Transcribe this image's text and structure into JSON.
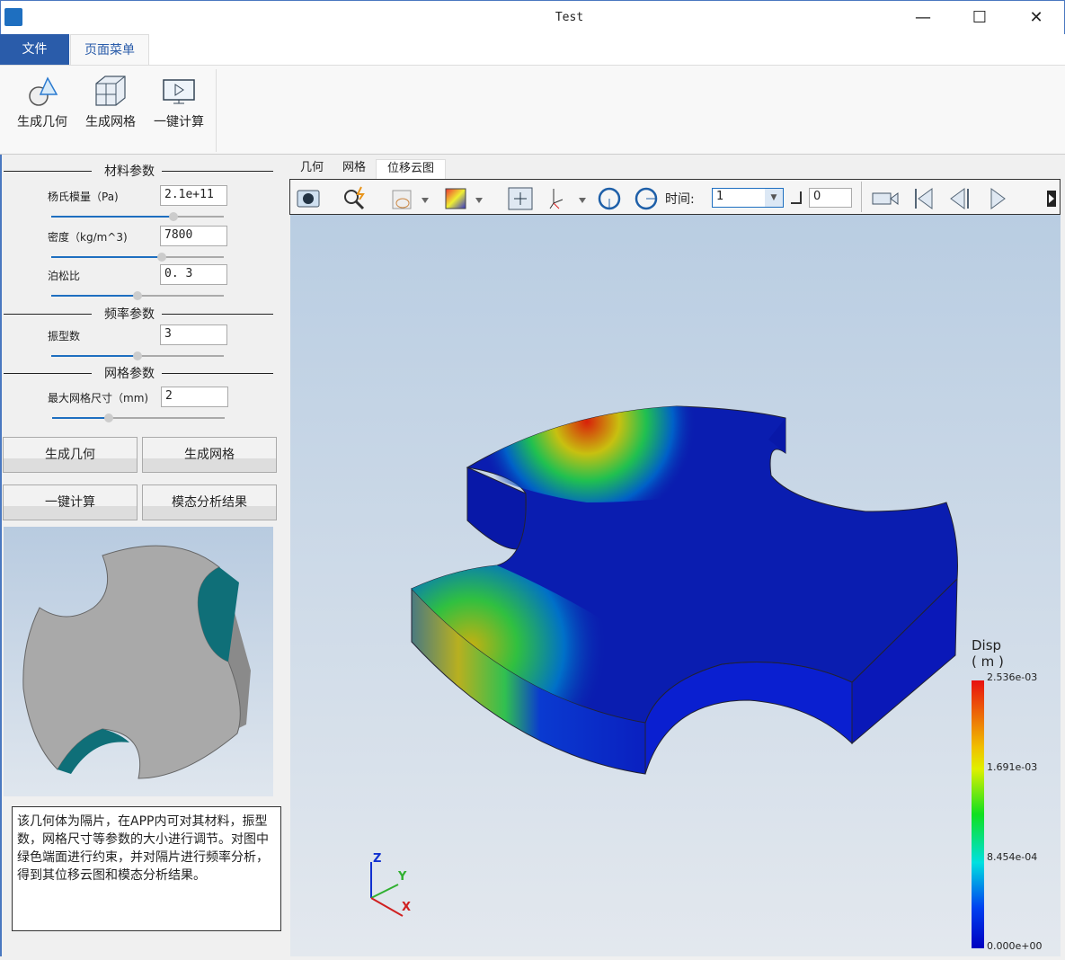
{
  "window": {
    "title": "Test",
    "min": "—",
    "max": "☐",
    "close": "✕"
  },
  "ribbon": {
    "tabs": [
      {
        "label": "文件",
        "active": false
      },
      {
        "label": "页面菜单",
        "active": true
      }
    ],
    "buttons": [
      {
        "label": "生成几何",
        "icon": "geometry-icon"
      },
      {
        "label": "生成网格",
        "icon": "mesh-cube-icon"
      },
      {
        "label": "一键计算",
        "icon": "monitor-play-icon"
      }
    ]
  },
  "panel": {
    "sections": {
      "material": "材料参数",
      "frequency": "频率参数",
      "mesh": "网格参数"
    },
    "fields": [
      {
        "label": "杨氏模量（Pa)",
        "value": "2.1e+11",
        "slider": 0.71
      },
      {
        "label": "密度（kg/m^3)",
        "value": "7800",
        "slider": 0.64
      },
      {
        "label": "泊松比",
        "value": "0. 3",
        "slider": 0.5
      },
      {
        "label": "振型数",
        "value": "3",
        "slider": 0.5
      },
      {
        "label": "最大网格尺寸（mm)",
        "value": "2",
        "slider": 0.33
      }
    ],
    "buttons": [
      "生成几何",
      "生成网格",
      "一键计算",
      "模态分析结果"
    ],
    "description": "该几何体为隔片，在APP内可对其材料，振型数，网格尺寸等参数的大小进行调节。对图中绿色端面进行约束，并对隔片进行频率分析，得到其位移云图和模态分析结果。"
  },
  "viewer": {
    "tabs": [
      "几何",
      "网格",
      "位移云图"
    ],
    "active_tab": "位移云图",
    "toolbar": {
      "time_label": "时间:",
      "time_value": "1",
      "step_value": "0"
    },
    "legend": {
      "title": "Disp",
      "unit": "( m )",
      "ticks": [
        "2.536e-03",
        "1.691e-03",
        "8.454e-04",
        "0.000e+00"
      ]
    },
    "axes": {
      "x": "X",
      "y": "Y",
      "z": "Z"
    }
  },
  "colors": {
    "accent": "#2a5caa",
    "slider": "#1e6fc0"
  }
}
